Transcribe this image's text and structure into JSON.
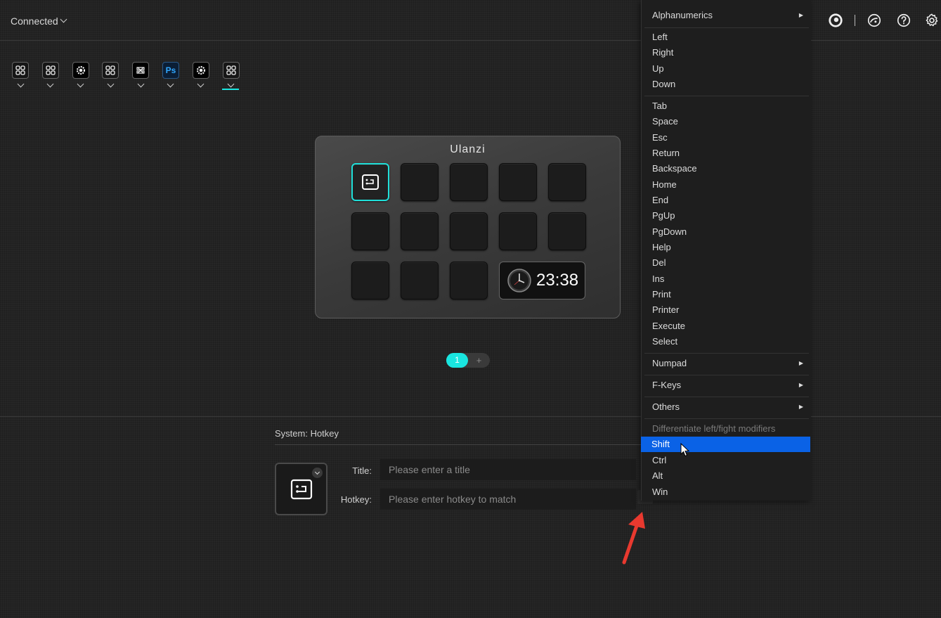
{
  "header": {
    "connection": "Connected",
    "icons": [
      "ulanzi-logo-icon",
      "palette-icon",
      "help-icon",
      "settings-icon"
    ]
  },
  "profiles": [
    {
      "icon": "grid-icon"
    },
    {
      "icon": "grid-icon"
    },
    {
      "icon": "gear-icon"
    },
    {
      "icon": "grid-icon"
    },
    {
      "icon": "capcut-icon"
    },
    {
      "icon": "photoshop-icon",
      "label": "Ps"
    },
    {
      "icon": "gear-icon"
    },
    {
      "icon": "grid-icon",
      "active": true
    }
  ],
  "device": {
    "brand": "Ulanzi",
    "clock_time": "23:38",
    "page": "1",
    "add_page": "+"
  },
  "editor": {
    "section_title": "System: Hotkey",
    "title_label": "Title:",
    "title_placeholder": "Please enter a title",
    "hotkey_label": "Hotkey:",
    "hotkey_placeholder": "Please enter hotkey to match",
    "dropdown_glyph": "▾"
  },
  "menu": {
    "items": [
      {
        "label": "Alphanumerics",
        "submenu": true
      },
      {
        "label": "Left"
      },
      {
        "label": "Right"
      },
      {
        "label": "Up"
      },
      {
        "label": "Down"
      },
      {
        "label": "Tab"
      },
      {
        "label": "Space"
      },
      {
        "label": "Esc"
      },
      {
        "label": "Return"
      },
      {
        "label": "Backspace"
      },
      {
        "label": "Home"
      },
      {
        "label": "End"
      },
      {
        "label": "PgUp"
      },
      {
        "label": "PgDown"
      },
      {
        "label": "Help"
      },
      {
        "label": "Del"
      },
      {
        "label": "Ins"
      },
      {
        "label": "Print"
      },
      {
        "label": "Printer"
      },
      {
        "label": "Execute"
      },
      {
        "label": "Select"
      },
      {
        "label": "Numpad",
        "submenu": true
      },
      {
        "label": "F-Keys",
        "submenu": true
      },
      {
        "label": "Others",
        "submenu": true
      },
      {
        "label": "Differentiate left/fight modifiers",
        "header": true
      },
      {
        "label": "Shift",
        "highlighted": true
      },
      {
        "label": "Ctrl"
      },
      {
        "label": "Alt"
      },
      {
        "label": "Win"
      }
    ],
    "submenu_glyph": "▶"
  },
  "colors": {
    "accent": "#19e6e0",
    "highlight": "#0a62e6",
    "annotation_arrow": "#e8392f"
  }
}
